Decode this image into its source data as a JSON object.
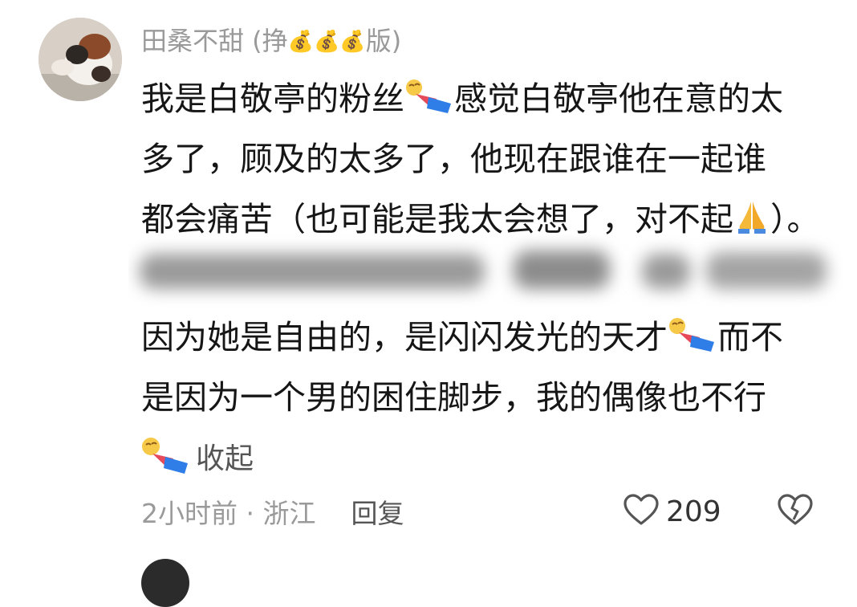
{
  "comment": {
    "username_prefix": "田桑不甜 (挣",
    "username_suffix": "版)",
    "username_icons": [
      "money-bag-icon",
      "money-bag-icon",
      "money-bag-icon"
    ],
    "lines": [
      {
        "text": "我是白敬亭的粉丝",
        "emoji": "lying-figure-emoji",
        "after": "感觉白敬亭他在意的太"
      },
      {
        "text": "多了，顾及的太多了，他现在跟谁在一起谁"
      },
      {
        "text": "都会痛苦（也可能是我太会想了，对不起",
        "emoji": "praying-hands-emoji",
        "after": "）。"
      }
    ],
    "blurred_note": "hidden text (blurred)",
    "lines2": [
      {
        "text": "因为她是自由的，是闪闪发光的天才",
        "emoji": "lying-figure-emoji",
        "after": "而不"
      },
      {
        "text": "是因为一个男的困住脚步，我的偶像也不行"
      }
    ],
    "collapse_label": "收起",
    "meta_time": "2小时前 · 浙江",
    "reply_label": "回复",
    "like_count": "209"
  },
  "icons": {
    "like": "heart-outline-icon",
    "dislike": "broken-heart-icon"
  },
  "colors": {
    "text": "#161616",
    "muted": "#9a9a9a",
    "action": "#555555"
  }
}
